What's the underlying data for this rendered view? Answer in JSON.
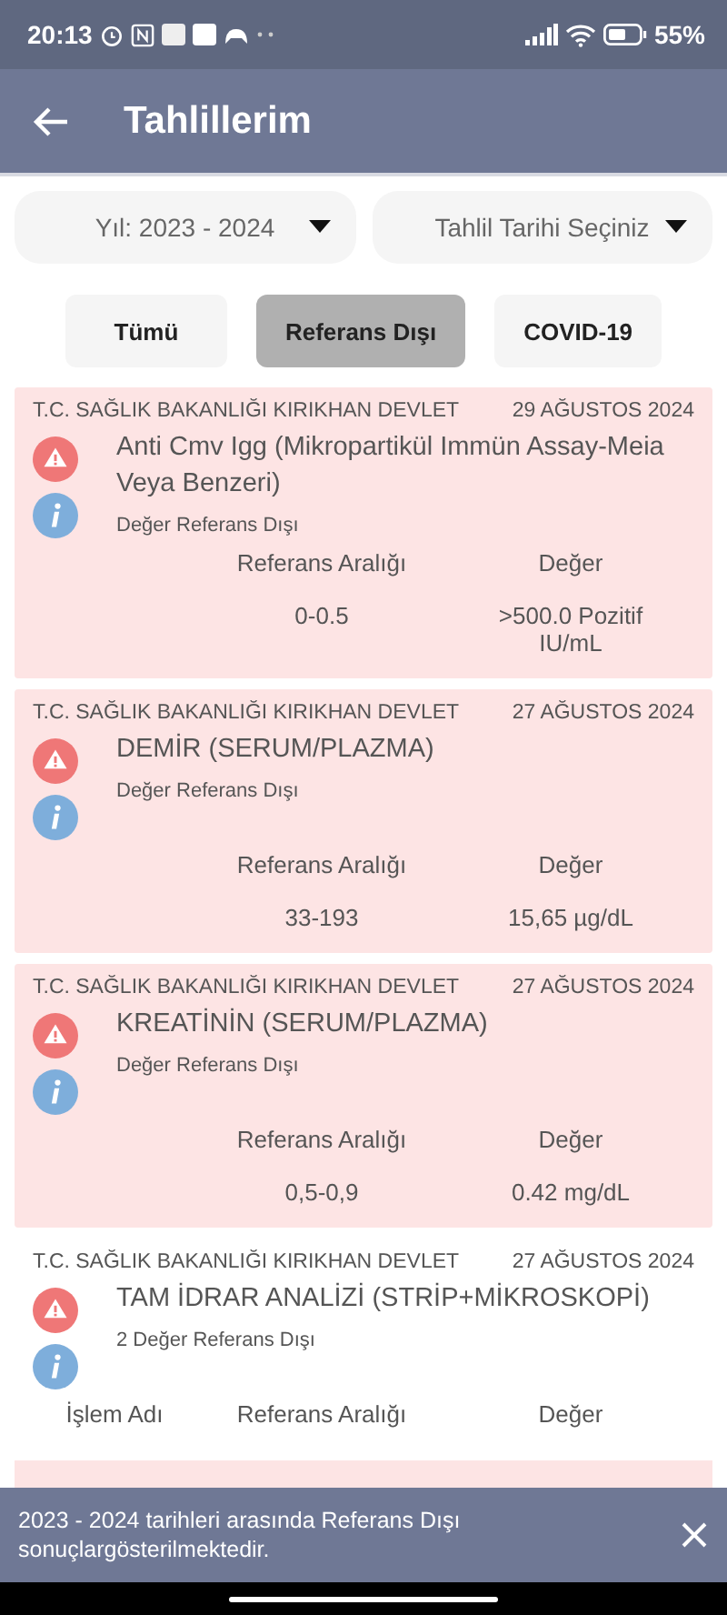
{
  "status_bar": {
    "time": "20:13",
    "battery": "55%"
  },
  "app_bar": {
    "title": "Tahlillerim"
  },
  "filters": [
    {
      "value": "Yıl: 2023 - 2024"
    },
    {
      "value": "Tahlil Tarihi Seçiniz"
    }
  ],
  "chips": [
    {
      "label": "Tümü",
      "selected": false
    },
    {
      "label": "Referans Dışı",
      "selected": true
    },
    {
      "label": "COVID-19",
      "selected": false
    }
  ],
  "results": [
    {
      "institution": "T.C. SAĞLIK BAKANLIĞI KIRIKHAN DEVLET",
      "date": "29 AĞUSTOS 2024",
      "test": "Anti Cmv Igg (Mikropartikül Immün Assay-Meia Veya Benzeri)",
      "note": "Değer Referans Dışı",
      "highlighted": true,
      "columns": [
        "Referans Aralığı",
        "Değer"
      ],
      "values": [
        "0-0.5",
        ">500.0 Pozitif IU/mL"
      ]
    },
    {
      "institution": "T.C. SAĞLIK BAKANLIĞI KIRIKHAN DEVLET",
      "date": "27 AĞUSTOS 2024",
      "test": "DEMİR (SERUM/PLAZMA)",
      "note": "Değer Referans Dışı",
      "highlighted": true,
      "columns": [
        "Referans Aralığı",
        "Değer"
      ],
      "values": [
        "33-193",
        "15,65 µg/dL"
      ]
    },
    {
      "institution": "T.C. SAĞLIK BAKANLIĞI KIRIKHAN DEVLET",
      "date": "27 AĞUSTOS 2024",
      "test": "KREATİNİN (SERUM/PLAZMA)",
      "note": "Değer Referans Dışı",
      "highlighted": true,
      "columns": [
        "Referans Aralığı",
        "Değer"
      ],
      "values": [
        "0,5-0,9",
        "0.42 mg/dL"
      ]
    },
    {
      "institution": "T.C. SAĞLIK BAKANLIĞI KIRIKHAN DEVLET",
      "date": "27 AĞUSTOS 2024",
      "test": "TAM İDRAR ANALİZİ (STRİP+MİKROSKOPİ)",
      "note": "2 Değer Referans Dışı",
      "highlighted": false,
      "columns": [
        "İşlem Adı",
        "Referans Aralığı",
        "Değer"
      ]
    }
  ],
  "snackbar": {
    "message": "2023 - 2024 tarihleri arasında Referans Dışı sonuçlargösterilmektedir."
  }
}
